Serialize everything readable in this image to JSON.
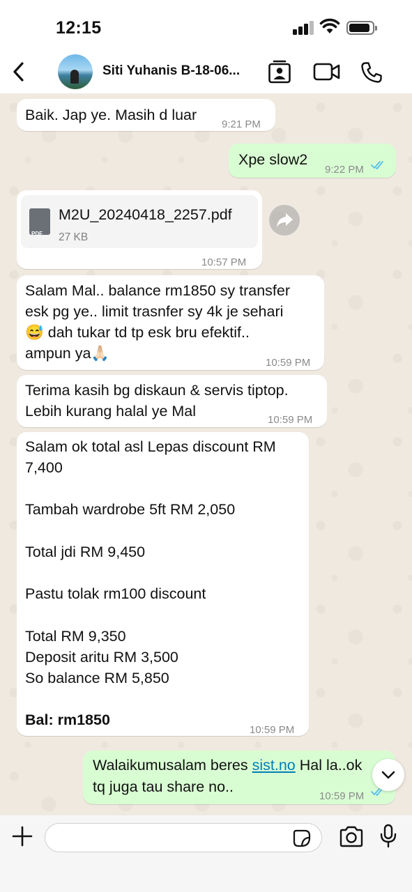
{
  "status_bar": {
    "time": "12:15",
    "battery_level": 0.9
  },
  "header": {
    "contact_name": "Siti Yuhanis B-18-06..."
  },
  "messages": [
    {
      "direction": "in",
      "text": "Baik. Jap ye. Masih d luar",
      "time": "9:21 PM"
    },
    {
      "direction": "out",
      "text": "Xpe slow2",
      "time": "9:22 PM",
      "status": "read"
    },
    {
      "direction": "in",
      "type": "file",
      "file_name": "M2U_20240418_2257.pdf",
      "file_type": "PDF",
      "file_size": "27 KB",
      "time": "10:57 PM"
    },
    {
      "direction": "in",
      "lines": [
        "Salam Mal.. balance rm1850 sy transfer",
        "esk pg ye.. limit trasnfer sy 4k je sehari",
        "😅 dah tukar td tp esk bru efektif..",
        "ampun ya🙏🏻"
      ],
      "time": "10:59 PM"
    },
    {
      "direction": "in",
      "lines": [
        "Terima kasih bg diskaun & servis tiptop.",
        "Lebih kurang halal ye Mal"
      ],
      "time": "10:59 PM"
    },
    {
      "direction": "in",
      "lines": [
        "Salam ok total asl Lepas discount RM",
        "7,400",
        "",
        "Tambah wardrobe 5ft RM 2,050",
        "",
        "Total jdi RM 9,450",
        "",
        "Pastu tolak rm100 discount",
        "",
        "Total RM 9,350",
        "Deposit aritu RM 3,500",
        "So balance RM 5,850",
        "",
        "Bal: rm1850"
      ],
      "time": "10:59 PM"
    },
    {
      "direction": "out",
      "line1_prefix": "Walaikumusalam beres ",
      "link": "sist.no",
      "line1_suffix": " Hal la..ok",
      "line2": "tq juga tau share no..",
      "time": "10:59 PM",
      "status": "read"
    }
  ],
  "input": {
    "placeholder": ""
  },
  "icons": [
    "back-icon",
    "contact-card-icon",
    "video-call-icon",
    "voice-call-icon",
    "pdf-icon",
    "forward-icon",
    "chevron-down-icon",
    "plus-icon",
    "sticker-icon",
    "camera-icon",
    "mic-icon"
  ],
  "colors": {
    "incoming_bubble": "#ffffff",
    "outgoing_bubble": "#d9fdd3",
    "read_ticks": "#53bdeb",
    "link": "#027eb5"
  }
}
